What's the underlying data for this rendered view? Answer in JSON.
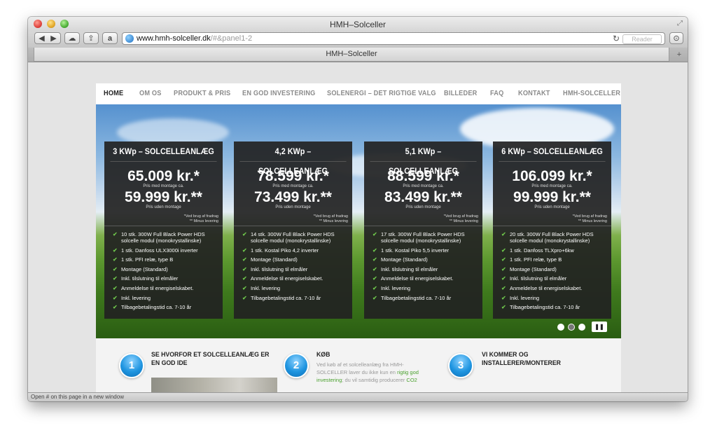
{
  "window": {
    "title": "HMH–Solceller"
  },
  "toolbar": {
    "back_icon": "◀",
    "forward_icon": "▶",
    "cloud_icon": "☁",
    "share_icon": "⇪",
    "readlater_icon": "a",
    "url_main": "www.hmh-solceller.dk",
    "url_path": "/#&panel1-2",
    "reload_icon": "↻",
    "reader_label": "Reader",
    "download_icon": "⊙"
  },
  "tabbar": {
    "tab_title": "HMH–Solceller",
    "new_tab_icon": "+"
  },
  "nav": {
    "items": [
      "HOME",
      "OM OS",
      "PRODUKT & PRIS",
      "EN GOD INVESTERING",
      "SOLENERGI – DET RIGTIGE VALG",
      "BILLEDER",
      "FAQ",
      "KONTAKT",
      "HMH-SOLCELLER"
    ]
  },
  "panels": [
    {
      "title": "3 KWp – SOLCELLEANLÆG",
      "price1": "65.009 kr.*",
      "price1_note": "Pris med montage ca.",
      "price2": "59.999 kr.**",
      "price2_note": "Pris uden montage",
      "footnote1": "*Ved brug af fradrag",
      "footnote2": "** Minus levering",
      "features": [
        "10 stk. 300W Full Black Power HDS solcelle modul (monokrystallinske)",
        "1 stk. Danfoss ULX3000i inverter",
        "1 stk. PFI relæ, type B",
        "Montage (Standard)",
        "Inkl. tilslutning til elmåler",
        "Anmeldelse til energiselskabet.",
        "Inkl. levering",
        "Tilbagebetalingstid ca. 7-10 år"
      ]
    },
    {
      "title": "4,2 KWp – SOLCELLEANLÆG",
      "price1": "78.599 kr.*",
      "price1_note": "Pris med montage ca.",
      "price2": "73.499 kr.**",
      "price2_note": "Pris uden montage",
      "footnote1": "*Ved brug af fradrag",
      "footnote2": "** Minus levering",
      "features": [
        "14 stk. 300W Full Black Power HDS solcelle modul (monokrystallinske)",
        "1 stk. Kostal Piko 4,2 inverter",
        "Montage (Standard)",
        "Inkl. tilslutning til elmåler",
        "Anmeldelse til energiselskabet.",
        "Inkl. levering",
        "Tilbagebetalingstid ca. 7-10 år"
      ]
    },
    {
      "title": "5,1 KWp – SOLCELLEANLÆG",
      "price1": "88.599 kr.*",
      "price1_note": "Pris med montage ca.",
      "price2": "83.499 kr.**",
      "price2_note": "Pris uden montage",
      "footnote1": "*Ved brug af fradrag",
      "footnote2": "** Minus levering",
      "features": [
        "17 stk. 300W Full Black Power HDS solcelle modul (monokrystallinske)",
        "1 stk. Kostal Piko 5,5 inverter",
        "Montage (Standard)",
        "Inkl. tilslutning til elmåler",
        "Anmeldelse til energiselskabet.",
        "Inkl. levering",
        "Tilbagebetalingstid ca. 7-10 år"
      ]
    },
    {
      "title": "6 KWp – SOLCELLEANLÆG",
      "price1": "106.099 kr.*",
      "price1_note": "Pris med montage ca.",
      "price2": "99.999 kr.**",
      "price2_note": "Pris uden montage",
      "footnote1": "*Ved brug af fradrag",
      "footnote2": "** Minus levering",
      "features": [
        "20 stk. 300W Full Black Power HDS solcelle modul (monokrystallinske)",
        "1 stk. Danfoss TLXpro+6kw",
        "1 stk. PFI relæ, type B",
        "Montage (Standard)",
        "Inkl. tilslutning til elmåler",
        "Anmeldelse til energiselskabet.",
        "Inkl. levering",
        "Tilbagebetalingstid ca. 7-10 år"
      ]
    }
  ],
  "slider": {
    "pause_icon": "❚❚"
  },
  "info": [
    {
      "number": "1",
      "title": "SE HVORFOR ET SOLCELLEANLÆG ER EN GOD IDE"
    },
    {
      "number": "2",
      "title": "KØB",
      "text_a": "Ved køb af et solcelleanlæg fra HMH-SOLCELLER laver du ikke kun en ",
      "text_link": "rigtig god investering",
      "text_b": "; du vil samtidig producerer ",
      "text_link2": "CO2"
    },
    {
      "number": "3",
      "title": "VI KOMMER OG INSTALLERER/MONTERER"
    }
  ],
  "status": {
    "text": "Open # on this page in a new window"
  }
}
